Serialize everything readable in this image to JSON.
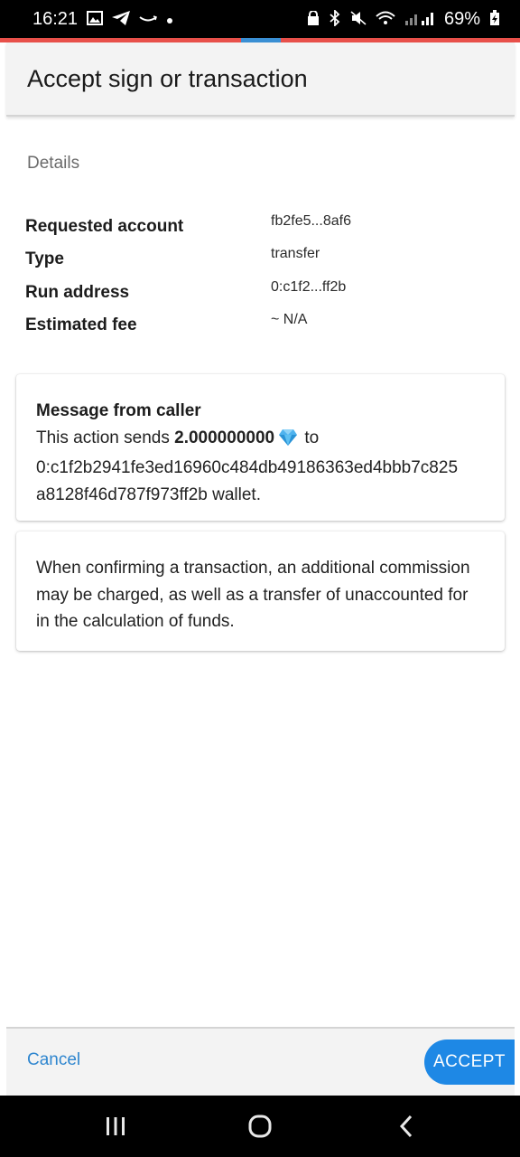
{
  "status_bar": {
    "time": "16:21",
    "left_icons": [
      "image-icon",
      "telegram-icon",
      "amazon-icon",
      "dot-icon"
    ],
    "right_icons": [
      "lock-icon",
      "bluetooth-icon",
      "mute-icon",
      "wifi-icon",
      "signal-icon"
    ],
    "battery": "69%"
  },
  "colors": {
    "accent": "#1e88e5",
    "progress_bar": "#e8504a",
    "progress_indicator": "#3a8fd4",
    "link": "#2f86cf"
  },
  "header": {
    "title": "Accept sign or transaction"
  },
  "details": {
    "section_title": "Details",
    "rows": [
      {
        "label": "Requested account",
        "value": "fb2fe5...8af6"
      },
      {
        "label": "Type",
        "value": "transfer"
      },
      {
        "label": "Run address",
        "value": "0:c1f2...ff2b"
      },
      {
        "label": "Estimated fee",
        "value": "~ N/A"
      }
    ]
  },
  "message_card": {
    "heading": "Message from caller",
    "text_before": "This action sends ",
    "amount": "2.000000000",
    "text_to": " to",
    "address_line1": "0:c1f2b2941fe3ed16960c484db49186363ed4bbb7c825",
    "address_line2": "a8128f46d787f973ff2b wallet.",
    "currency_icon": "diamond-icon"
  },
  "warning_card": {
    "text": "When confirming a transaction, an additional commission may be charged, as well as a transfer of unaccounted for in the calculation of funds."
  },
  "actions": {
    "cancel_label": "Cancel",
    "accept_label": "ACCEPT"
  },
  "nav_bar": {
    "buttons": [
      "recents-icon",
      "home-icon",
      "back-icon"
    ]
  }
}
